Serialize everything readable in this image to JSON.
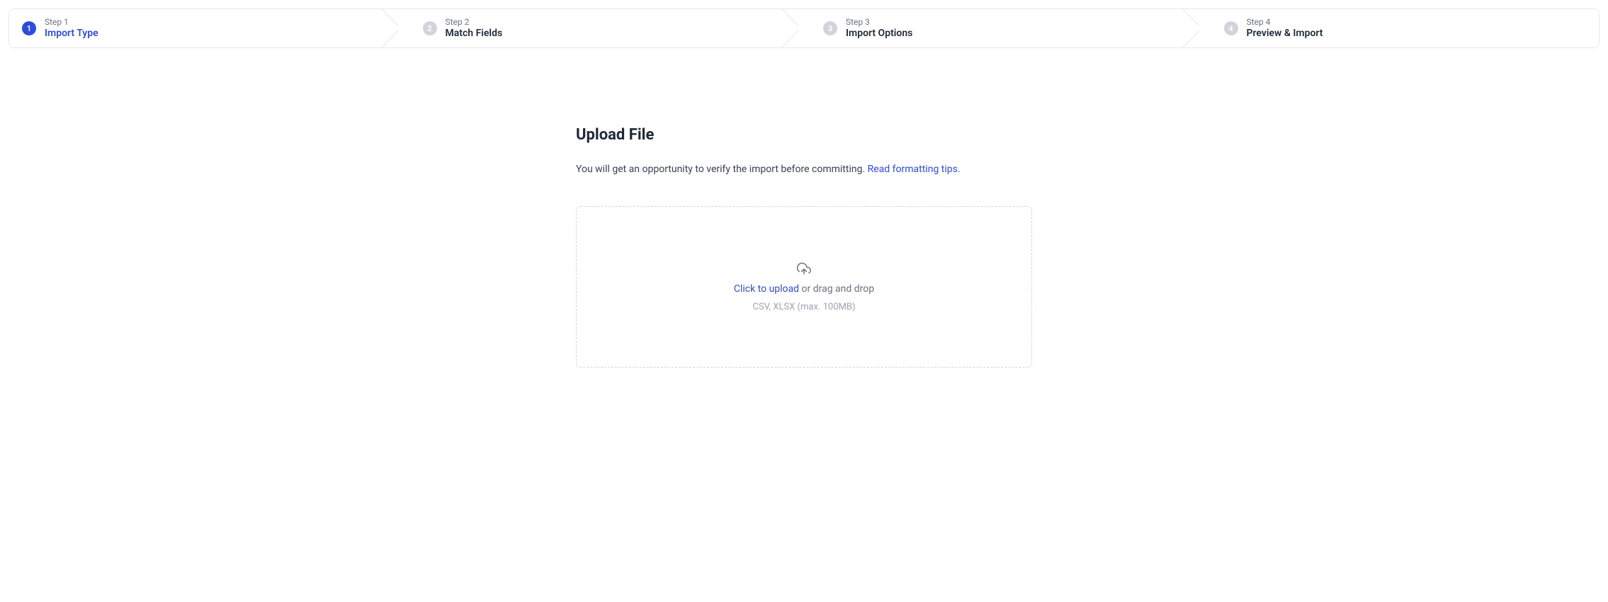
{
  "colors": {
    "accent": "#2f4bdb",
    "border": "#e5e7eb",
    "muted": "#6b7280"
  },
  "stepper": {
    "active_index": 0,
    "steps": [
      {
        "label": "Step 1",
        "title": "Import Type",
        "num": "1"
      },
      {
        "label": "Step 2",
        "title": "Match Fields",
        "num": "2"
      },
      {
        "label": "Step 3",
        "title": "Import Options",
        "num": "3"
      },
      {
        "label": "Step 4",
        "title": "Preview & Import",
        "num": "4"
      }
    ]
  },
  "main": {
    "heading": "Upload File",
    "subtext_prefix": "You will get an opportunity to verify the import before committing. ",
    "subtext_link": "Read formatting tips",
    "subtext_suffix": "."
  },
  "dropzone": {
    "click_text": "Click to upload",
    "rest_text": " or drag and drop",
    "hint": "CSV, XLSX (max. 100MB)"
  }
}
